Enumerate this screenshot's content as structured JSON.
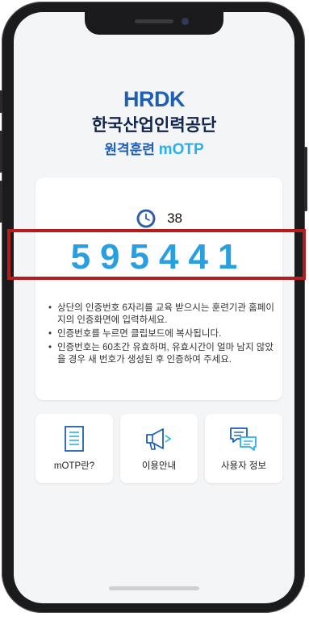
{
  "brand": {
    "logo_text": "HRDK",
    "org_name": "한국산업인력공단",
    "app_title_prefix": "원격훈련 ",
    "app_title_accent": "mOTP"
  },
  "otp": {
    "timer_icon": "clock-icon",
    "seconds_remaining": "38",
    "code": "595441"
  },
  "instructions": [
    "상단의 인증번호 6자리를 교육 받으시는 훈련기관 홈페이지의 인증화면에 입력하세요.",
    "인증번호를 누르면 클립보드에 복사됩니다.",
    "인증번호는 60초간 유효하며, 유효시간이 얼마 남지 않았을 경우 새 번호가 생성된 후 인증하여 주세요."
  ],
  "menu": [
    {
      "label": "mOTP란?",
      "icon": "document-icon"
    },
    {
      "label": "이용안내",
      "icon": "megaphone-icon"
    },
    {
      "label": "사용자 정보",
      "icon": "chat-icon"
    }
  ],
  "colors": {
    "brand_blue": "#1d5fb4",
    "accent_cyan": "#2ab0e8",
    "otp_blue": "#2a9fe0",
    "highlight_red": "#b71c1c"
  }
}
